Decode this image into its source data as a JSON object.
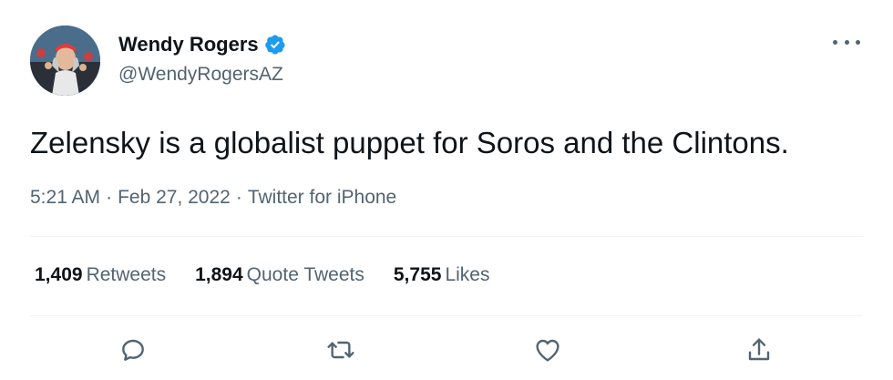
{
  "author": {
    "display_name": "Wendy Rogers",
    "handle": "@WendyRogersAZ",
    "verified": true,
    "verified_color": "#1d9bf0"
  },
  "tweet": {
    "text": "Zelensky is a globalist puppet for Soros and the Clintons."
  },
  "meta": {
    "time": "5:21 AM",
    "separator": "·",
    "date": "Feb 27, 2022",
    "source": "Twitter for iPhone"
  },
  "stats": {
    "retweets": {
      "count": "1,409",
      "label": "Retweets"
    },
    "quote_tweets": {
      "count": "1,894",
      "label": "Quote Tweets"
    },
    "likes": {
      "count": "5,755",
      "label": "Likes"
    }
  },
  "actions": {
    "reply_icon": "reply-icon",
    "retweet_icon": "retweet-icon",
    "like_icon": "heart-icon",
    "share_icon": "share-icon"
  },
  "colors": {
    "text": "#0f1419",
    "secondary": "#536471",
    "divider": "#eff3f4"
  }
}
